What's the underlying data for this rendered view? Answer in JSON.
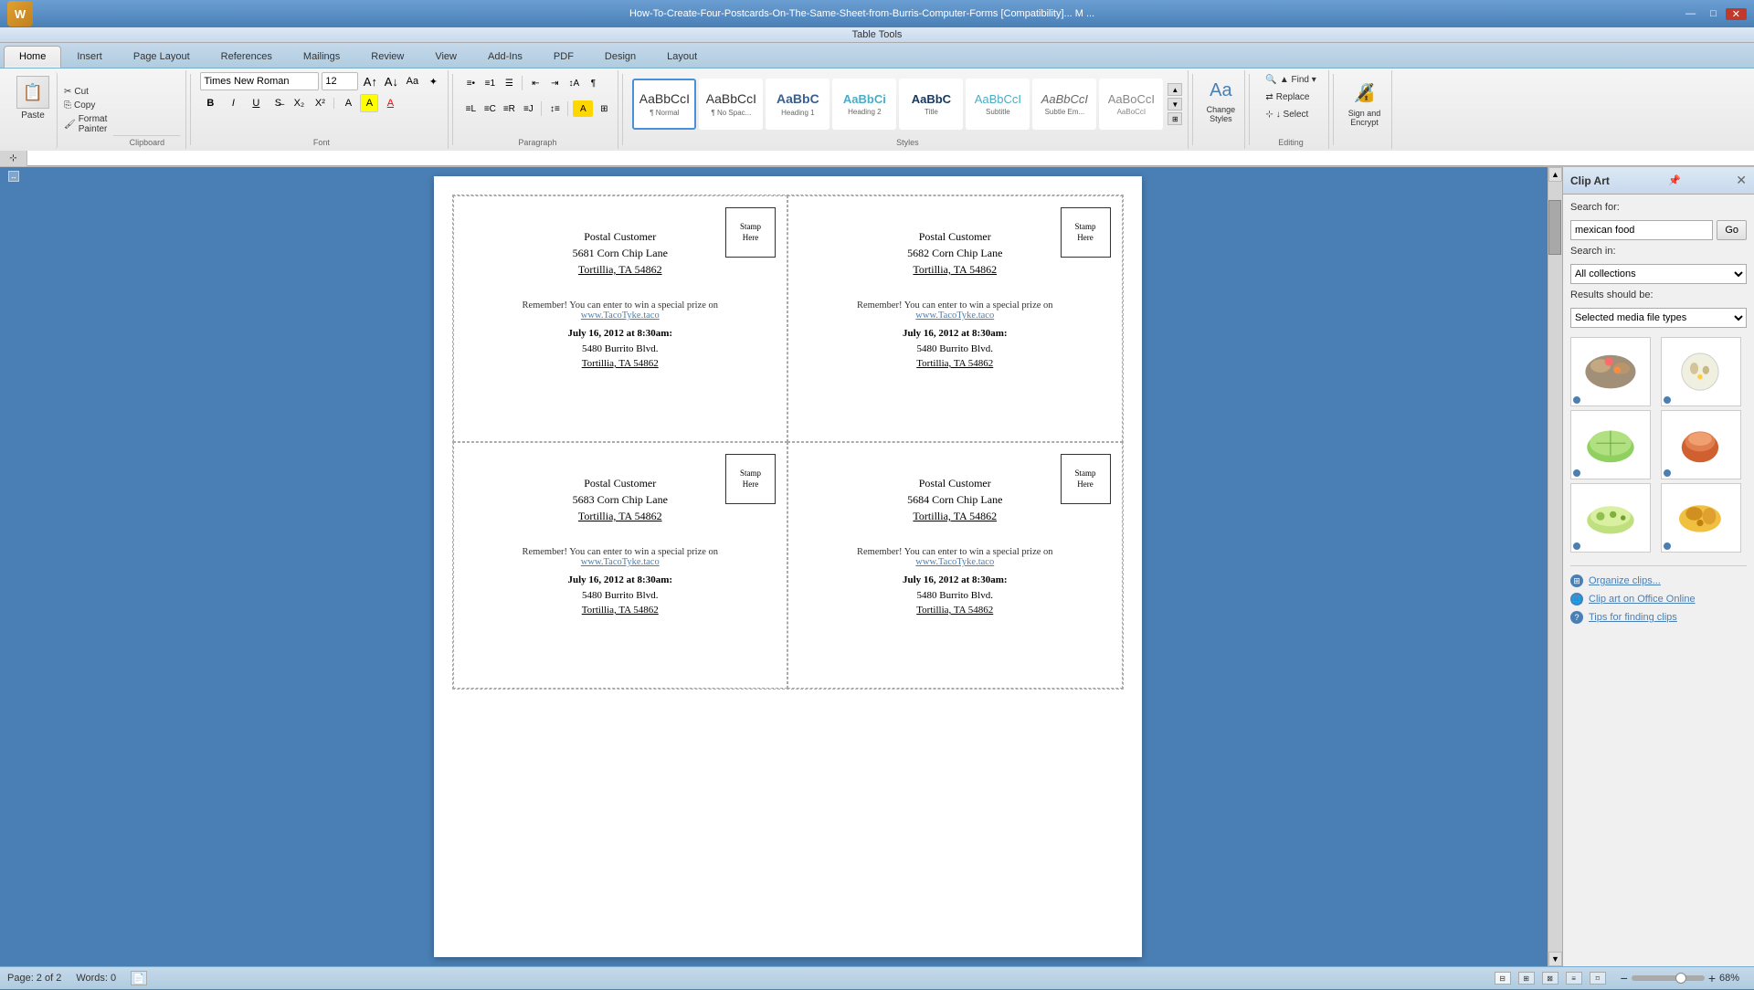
{
  "titlebar": {
    "text": "How-To-Create-Four-Postcards-On-The-Same-Sheet-from-Burris-Computer-Forms [Compatibility]... M ...",
    "controls": [
      "—",
      "□",
      "✕"
    ]
  },
  "tabletools": {
    "label": "Table Tools"
  },
  "tabs": [
    {
      "id": "home",
      "label": "Home",
      "active": true
    },
    {
      "id": "insert",
      "label": "Insert"
    },
    {
      "id": "page-layout",
      "label": "Page Layout"
    },
    {
      "id": "references",
      "label": "References"
    },
    {
      "id": "mailings",
      "label": "Mailings"
    },
    {
      "id": "review",
      "label": "Review"
    },
    {
      "id": "view",
      "label": "View"
    },
    {
      "id": "add-ins",
      "label": "Add-Ins"
    },
    {
      "id": "pdf",
      "label": "PDF"
    },
    {
      "id": "design",
      "label": "Design"
    },
    {
      "id": "layout",
      "label": "Layout"
    }
  ],
  "ribbon": {
    "clipboard": {
      "label": "Clipboard",
      "paste": "Paste",
      "copy": "Copy",
      "cut": "Cut",
      "format_painter": "Format Painter"
    },
    "font": {
      "label": "Font",
      "name": "Times New Roman",
      "size": "12",
      "buttons": [
        "B",
        "I",
        "U"
      ]
    },
    "paragraph": {
      "label": "Paragraph"
    },
    "styles": {
      "label": "Styles",
      "items": [
        {
          "label": "¶ Normal",
          "style": "normal"
        },
        {
          "label": "¶ No Spac...",
          "style": "no-space"
        },
        {
          "label": "Heading 1",
          "style": "heading1"
        },
        {
          "label": "Heading 2",
          "style": "heading2"
        },
        {
          "label": "Title",
          "style": "title"
        },
        {
          "label": "Subtitle",
          "style": "subtitle"
        },
        {
          "label": "Subtle Em...",
          "style": "subtle-em"
        },
        {
          "label": "AaBoCcI",
          "style": "other"
        }
      ]
    },
    "change_styles": {
      "label": "Change\nStyles"
    },
    "editing": {
      "label": "Editing",
      "find": "▲ Find ▾",
      "replace": "Replace",
      "select": "↓ Select"
    },
    "sign": {
      "label": "Sign and\nEncrypt"
    }
  },
  "clipart": {
    "title": "Clip Art",
    "search_label": "Search for:",
    "search_value": "mexican food",
    "go_button": "Go",
    "search_in_label": "Search in:",
    "search_in_value": "All collections",
    "results_label": "Results should be:",
    "results_value": "Selected media file types",
    "links": [
      {
        "label": "Organize clips..."
      },
      {
        "label": "Clip art on Office Online"
      },
      {
        "label": "Tips for finding clips"
      }
    ],
    "close_icon": "✕"
  },
  "postcards": [
    {
      "id": 1,
      "stamp_line1": "Stamp",
      "stamp_line2": "Here",
      "name": "Postal Customer",
      "address1": "5681 Corn Chip Lane",
      "address2": "Tortillia, TA 54862",
      "promo": "Remember! You can enter to win a special prize on",
      "url": "www.TacoTyke.taco",
      "event_date": "July 16, 2012 at 8:30am:",
      "venue1": "5480 Burrito Blvd.",
      "venue2": "Tortillia, TA 54862"
    },
    {
      "id": 2,
      "stamp_line1": "Stamp",
      "stamp_line2": "Here",
      "name": "Postal Customer",
      "address1": "5682 Corn Chip Lane",
      "address2": "Tortillia, TA 54862",
      "promo": "Remember! You can enter to win a special prize on",
      "url": "www.TacoTyke.taco",
      "event_date": "July 16, 2012 at 8:30am:",
      "venue1": "5480 Burrito Blvd.",
      "venue2": "Tortillia, TA 54862"
    },
    {
      "id": 3,
      "stamp_line1": "Stamp",
      "stamp_line2": "Here",
      "name": "Postal Customer",
      "address1": "5683 Corn Chip Lane",
      "address2": "Tortillia, TA 54862",
      "promo": "Remember! You can enter to win a special prize on",
      "url": "www.TacoTyke.taco",
      "event_date": "July 16, 2012 at 8:30am:",
      "venue1": "5480 Burrito Blvd.",
      "venue2": "Tortillia, TA 54862"
    },
    {
      "id": 4,
      "stamp_line1": "Stamp",
      "stamp_line2": "Here",
      "name": "Postal Customer",
      "address1": "5684 Corn Chip Lane",
      "address2": "Tortillia, TA 54862",
      "promo": "Remember! You can enter to win a special prize on",
      "url": "www.TacoTyke.taco",
      "event_date": "July 16, 2012 at 8:30am:",
      "venue1": "5480 Burrito Blvd.",
      "venue2": "Tortillia, TA 54862"
    }
  ],
  "statusbar": {
    "page": "Page: 2 of 2",
    "words": "Words: 0",
    "zoom": "68%"
  }
}
